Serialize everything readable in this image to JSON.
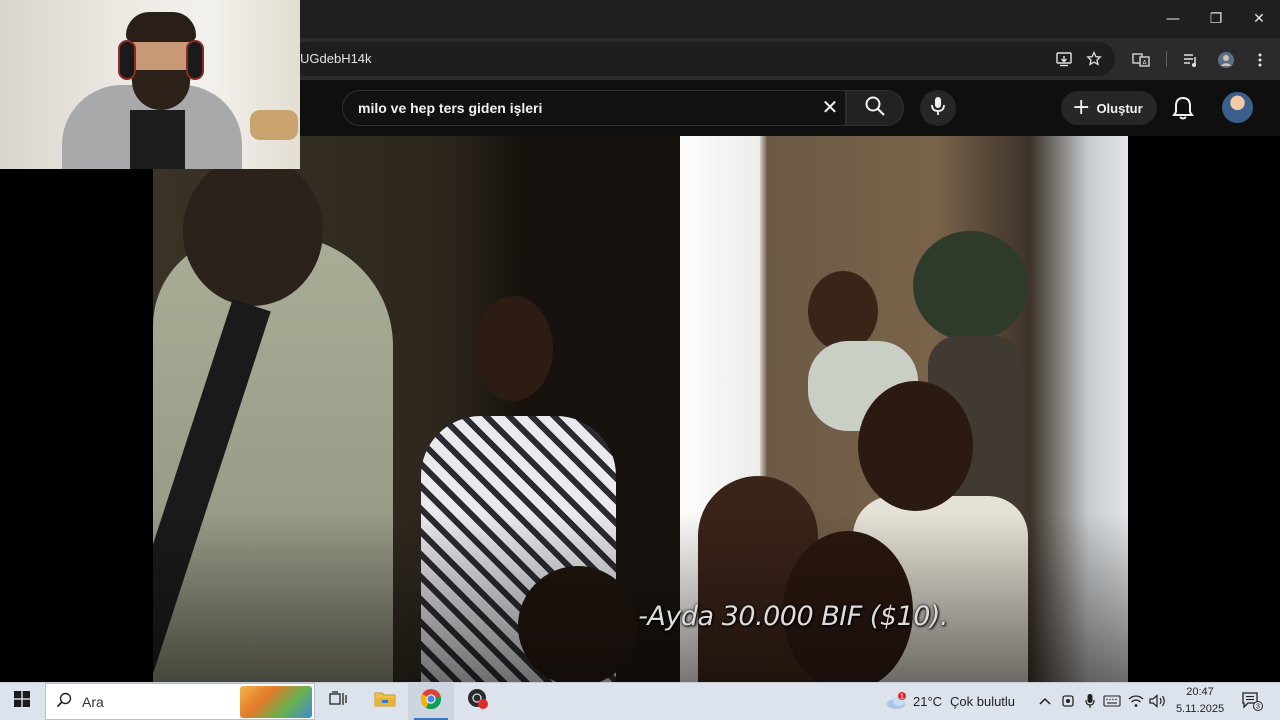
{
  "window": {
    "minimize_glyph": "—",
    "maximize_glyph": "❐",
    "close_glyph": "✕"
  },
  "address_bar": {
    "url": "UGdebH14k"
  },
  "youtube": {
    "search_query": "milo ve hep ters giden işleri",
    "create_label": "Oluştur",
    "create_glyph": "+",
    "clear_glyph": "✕"
  },
  "video": {
    "subtitle": "-Ayda 30.000 BIF ($10)."
  },
  "taskbar": {
    "search_placeholder": "Ara",
    "weather_temp": "21°C",
    "weather_desc": "Çok bulutlu",
    "weather_badge": "1",
    "clock_time": "20:47",
    "clock_date": "5.11.2025",
    "notification_count": "3"
  },
  "colors": {
    "chrome_dark": "#1f1f1f",
    "youtube_bg": "#0f0f0f",
    "taskbar_bg": "#dde3ec",
    "accent": "#3a78c2"
  }
}
